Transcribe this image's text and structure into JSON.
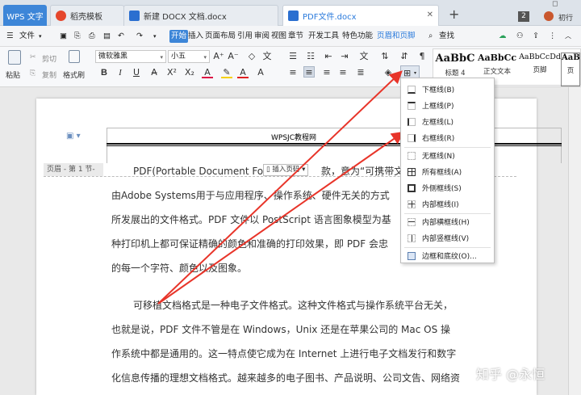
{
  "tabs": {
    "app": "WPS 文字",
    "items": [
      {
        "label": "稻壳模板"
      },
      {
        "label": "新建 DOCX 文档.docx"
      },
      {
        "label": "PDF文件.docx"
      }
    ],
    "add": "+",
    "badge": "2",
    "user": "初行"
  },
  "menu": {
    "file": "文件",
    "items": [
      "开始",
      "插入",
      "页面布局",
      "引用",
      "审阅",
      "视图",
      "章节",
      "开发工具",
      "特色功能",
      "页眉和页脚"
    ],
    "search": "查找"
  },
  "ribbon": {
    "paste": "粘贴",
    "cut": "剪切",
    "copy": "复制",
    "format_painter": "格式刷",
    "font_name": "微软雅黑",
    "font_size": "小五",
    "bold": "B",
    "italic": "I",
    "underline": "U",
    "font_color": "A",
    "styles": [
      {
        "preview": "AaBbC",
        "label": "标题 4"
      },
      {
        "preview": "AaBbCc",
        "label": "正文文本"
      },
      {
        "preview": "AaBbCcDd",
        "label": "页脚"
      },
      {
        "preview": "AaBl",
        "label": "页"
      }
    ]
  },
  "document": {
    "header_title": "WPSJC教程网",
    "header_tag": "页眉 - 第 1 节-",
    "insert_page": "插入页码",
    "lines": [
      "PDF(Portable Document Fo",
      "款，意为“可携带文",
      "由Adobe Systems用于与应用程序、操作系统、硬件无关的方式",
      "所发展出的文件格式。PDF 文件以 PostScript 语言图象模型为基",
      "种打印机上都可保证精确的颜色和准确的打印效果，即 PDF 会忠",
      "的每一个字符、颜色以及图象。",
      "可移植文档格式是一种电子文件格式。这种文件格式与操作系统平台无关，",
      "也就是说，PDF 文件不管是在 Windows，Unix 还是在苹果公司的 Mac OS 操",
      "作系统中都是通用的。这一特点使它成为在 Internet 上进行电子文档发行和数字",
      "化信息传播的理想文档格式。越来越多的电子图书、产品说明、公司文告、网络资"
    ]
  },
  "border_menu": {
    "items": [
      "下框线(B)",
      "上框线(P)",
      "左框线(L)",
      "右框线(R)",
      "无框线(N)",
      "所有框线(A)",
      "外侧框线(S)",
      "内部框线(I)",
      "内部横框线(H)",
      "内部竖框线(V)",
      "边框和底纹(O)..."
    ]
  },
  "watermark": "知乎 @永恒",
  "colors": {
    "accent": "#3d86d8",
    "arrow": "#e8352a"
  }
}
